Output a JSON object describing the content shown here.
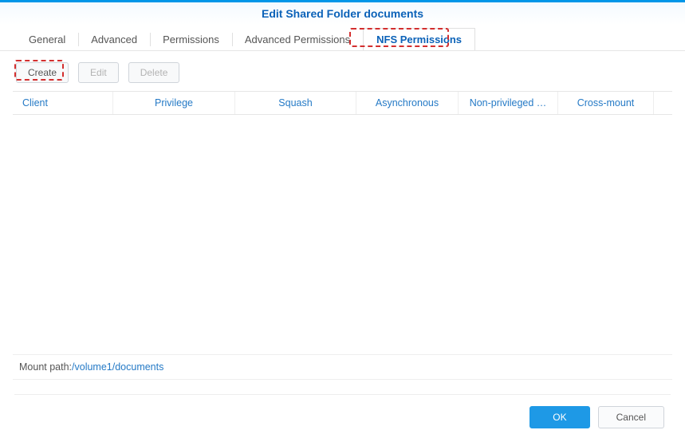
{
  "title": "Edit Shared Folder documents",
  "tabs": {
    "general": "General",
    "advanced": "Advanced",
    "permissions": "Permissions",
    "advanced_permissions": "Advanced Permissions",
    "nfs_permissions": "NFS Permissions"
  },
  "toolbar": {
    "create": "Create",
    "edit": "Edit",
    "delete": "Delete"
  },
  "columns": {
    "client": "Client",
    "privilege": "Privilege",
    "squash": "Squash",
    "asynchronous": "Asynchronous",
    "nonpriv": "Non-privileged …",
    "crossmount": "Cross-mount"
  },
  "rows": [],
  "mount_path": {
    "label": "Mount path:",
    "value": "/volume1/documents"
  },
  "footer": {
    "ok": "OK",
    "cancel": "Cancel"
  }
}
